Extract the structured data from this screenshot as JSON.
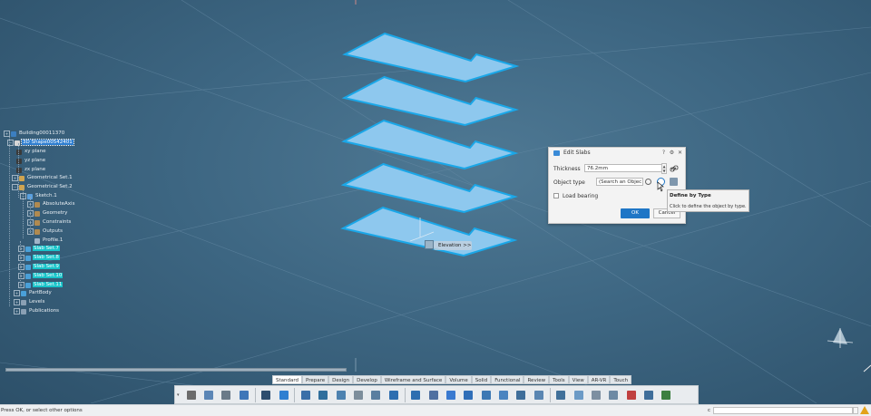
{
  "tree": {
    "items": [
      {
        "label": "Building00011370",
        "style": "normal"
      },
      {
        "label": "3D Shape00542401",
        "style": "sel"
      },
      {
        "label": "xy plane",
        "style": "normal"
      },
      {
        "label": "yz plane",
        "style": "normal"
      },
      {
        "label": "zx plane",
        "style": "normal"
      },
      {
        "label": "Geometrical Set.1",
        "style": "normal"
      },
      {
        "label": "Geometrical Set.2",
        "style": "normal"
      },
      {
        "label": "Sketch.1",
        "style": "normal"
      },
      {
        "label": "AbsoluteAxis",
        "style": "normal"
      },
      {
        "label": "Geometry",
        "style": "normal"
      },
      {
        "label": "Constraints",
        "style": "normal"
      },
      {
        "label": "Outputs",
        "style": "normal"
      },
      {
        "label": "Profile.1",
        "style": "normal"
      },
      {
        "label": "Slab Set.7",
        "style": "hl"
      },
      {
        "label": "Slab Set.8",
        "style": "hl"
      },
      {
        "label": "Slab Set.9",
        "style": "hl"
      },
      {
        "label": "Slab Set.10",
        "style": "hl"
      },
      {
        "label": "Slab Set.11",
        "style": "hl"
      },
      {
        "label": "PartBody",
        "style": "normal"
      },
      {
        "label": "Levels",
        "style": "normal"
      },
      {
        "label": "Publications",
        "style": "normal"
      }
    ]
  },
  "dialog": {
    "title": "Edit Slabs",
    "thickness_label": "Thickness",
    "thickness_value": "76.2mm",
    "object_type_label": "Object type",
    "object_type_value": "(Search an Objec",
    "load_bearing_label": "Load bearing",
    "ok_label": "OK",
    "cancel_label": "Cancel"
  },
  "tooltip": {
    "title": "Define by Type",
    "body": "Click to define the object by type."
  },
  "elevation_label": "Elevation >>",
  "tabs": [
    {
      "label": "Standard",
      "active": true
    },
    {
      "label": "Prepare",
      "active": false
    },
    {
      "label": "Design",
      "active": false
    },
    {
      "label": "Develop",
      "active": false
    },
    {
      "label": "Wireframe and Surface",
      "active": false
    },
    {
      "label": "Volume",
      "active": false
    },
    {
      "label": "Solid",
      "active": false
    },
    {
      "label": "Functional",
      "active": false
    },
    {
      "label": "Review",
      "active": false
    },
    {
      "label": "Tools",
      "active": false
    },
    {
      "label": "View",
      "active": false
    },
    {
      "label": "AR-VR",
      "active": false
    },
    {
      "label": "Touch",
      "active": false
    }
  ],
  "toolbar_icons": [
    "cut-icon",
    "copy-icon",
    "paste-icon",
    "undo-icon",
    "zoom-icon",
    "select-icon",
    "sketch-icon",
    "layer-icon",
    "stairs-icon",
    "grid-icon",
    "measure-icon",
    "wall-icon",
    "slab-icon",
    "door-icon",
    "window-icon",
    "beam-icon",
    "column-icon",
    "frame-icon",
    "column-grid-icon",
    "opening-icon",
    "table-icon",
    "box-icon",
    "tag-icon",
    "marker-icon",
    "sphere-icon",
    "search-icon",
    "render-icon"
  ],
  "status": {
    "message": "Press OK, or select other options",
    "cmd_prefix": "c"
  },
  "colors": {
    "accent": "#1f76c6",
    "highlight": "#17c3c9",
    "slab_fill": "#8ec8ee",
    "slab_edge": "#1aa7e8"
  }
}
